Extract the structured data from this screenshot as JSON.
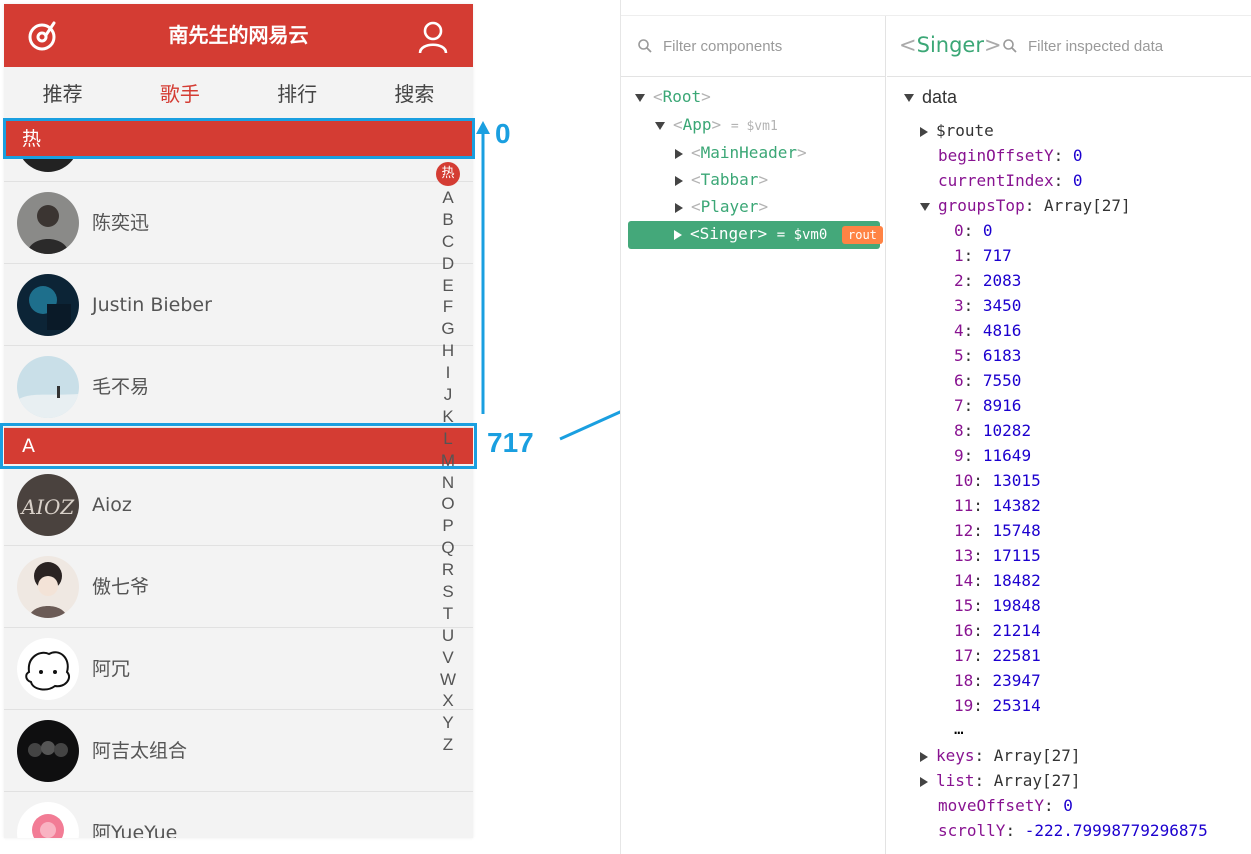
{
  "app": {
    "title": "南先生的网易云",
    "tabs": [
      "推荐",
      "歌手",
      "排行",
      "搜索"
    ],
    "active_tab": "歌手",
    "groups": [
      {
        "title": "热",
        "singers": [
          "陈奕迅",
          "Justin Bieber",
          "毛不易"
        ]
      },
      {
        "title": "A",
        "singers": [
          "Aioz",
          "傲七爷",
          "阿冗",
          "阿吉太组合",
          "阿YueYue"
        ]
      }
    ],
    "shortcut": {
      "hot": "热",
      "letters": [
        "A",
        "B",
        "C",
        "D",
        "E",
        "F",
        "G",
        "H",
        "I",
        "J",
        "K",
        "L",
        "M",
        "N",
        "O",
        "P",
        "Q",
        "R",
        "S",
        "T",
        "U",
        "V",
        "W",
        "X",
        "Y",
        "Z"
      ]
    }
  },
  "annotations": {
    "top_value": "0",
    "second_value": "717",
    "color": "#1a9fe0"
  },
  "devtools": {
    "components_placeholder": "Filter components",
    "inspected_placeholder": "Filter inspected data",
    "inspected_component": "Singer",
    "tree": {
      "root": "Root",
      "app": "App",
      "app_vm": "= $vm1",
      "children": [
        "MainHeader",
        "Tabbar",
        "Player"
      ],
      "selected": "Singer",
      "selected_vm": "= $vm0",
      "selected_badge": "rout"
    },
    "data": {
      "section": "data",
      "route_key": "$route",
      "beginOffsetY": {
        "key": "beginOffsetY",
        "value": "0"
      },
      "currentIndex": {
        "key": "currentIndex",
        "value": "0"
      },
      "groupsTop": {
        "key": "groupsTop",
        "type": "Array[27]",
        "items": [
          "0",
          "717",
          "2083",
          "3450",
          "4816",
          "6183",
          "7550",
          "8916",
          "10282",
          "11649",
          "13015",
          "14382",
          "15748",
          "17115",
          "18482",
          "19848",
          "21214",
          "22581",
          "23947",
          "25314"
        ],
        "more": "…"
      },
      "keys": {
        "key": "keys",
        "type": "Array[27]"
      },
      "list": {
        "key": "list",
        "type": "Array[27]"
      },
      "moveOffsetY": {
        "key": "moveOffsetY",
        "value": "0"
      },
      "scrollY": {
        "key": "scrollY",
        "value": "-222.79998779296875"
      }
    }
  },
  "colors": {
    "brand_red": "#d43c33",
    "devtools_green": "#3ba776",
    "selected_row": "#44a87a",
    "badge_orange": "#ff8344"
  }
}
